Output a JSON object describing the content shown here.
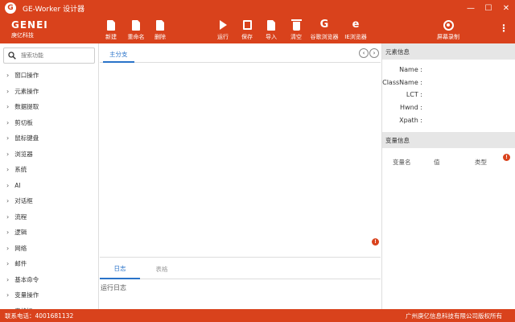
{
  "window": {
    "title": "GE-Worker 设计器",
    "logo_letter": "G",
    "controls": {
      "minimize": "—",
      "maximize": "☐",
      "close": "✕"
    }
  },
  "brand": {
    "name": "GENEI",
    "subtitle": "庚亿科技"
  },
  "toolbar": {
    "new": "新建",
    "rename": "重命名",
    "delete": "删除",
    "run": "运行",
    "save": "保存",
    "import": "导入",
    "clear": "清空",
    "chrome": "谷歌浏览器",
    "ie": "IE浏览器",
    "screen_record": "屏幕录制",
    "chrome_glyph": "G",
    "ie_glyph": "e",
    "more_glyph": "⋮"
  },
  "sidebar": {
    "search_placeholder": "搜索功能",
    "items": [
      {
        "label": "窗口操作"
      },
      {
        "label": "元素操作"
      },
      {
        "label": "数据提取"
      },
      {
        "label": "剪切板"
      },
      {
        "label": "鼠标键盘"
      },
      {
        "label": "浏览器"
      },
      {
        "label": "系统"
      },
      {
        "label": "AI"
      },
      {
        "label": "对话框"
      },
      {
        "label": "流程"
      },
      {
        "label": "逻辑"
      },
      {
        "label": "网络"
      },
      {
        "label": "邮件"
      },
      {
        "label": "基本命令"
      },
      {
        "label": "变量操作"
      },
      {
        "label": "表格操"
      }
    ]
  },
  "center": {
    "main_tab": "主分支",
    "prev_arrow": "‹",
    "next_arrow": "›",
    "log_tabs": {
      "log": "日志",
      "table": "表格"
    },
    "log_label": "运行日志",
    "badge_glyph": "!"
  },
  "right_panel": {
    "element_info_title": "元素信息",
    "props": [
      {
        "label": "Name :"
      },
      {
        "label": "ClassName :"
      },
      {
        "label": "LCT :"
      },
      {
        "label": "Hwnd :"
      },
      {
        "label": "Xpath :"
      }
    ],
    "variable_info_title": "变量信息",
    "var_columns": {
      "name": "变量名",
      "value": "值",
      "type": "类型"
    }
  },
  "statusbar": {
    "phone": "联系电话：4001681132",
    "copyright": "广州庚亿信息科技有限公司版权所有"
  },
  "colors": {
    "brand": "#d9421c",
    "accent_blue": "#2a73c9",
    "panel_header": "#e6e6e6"
  }
}
